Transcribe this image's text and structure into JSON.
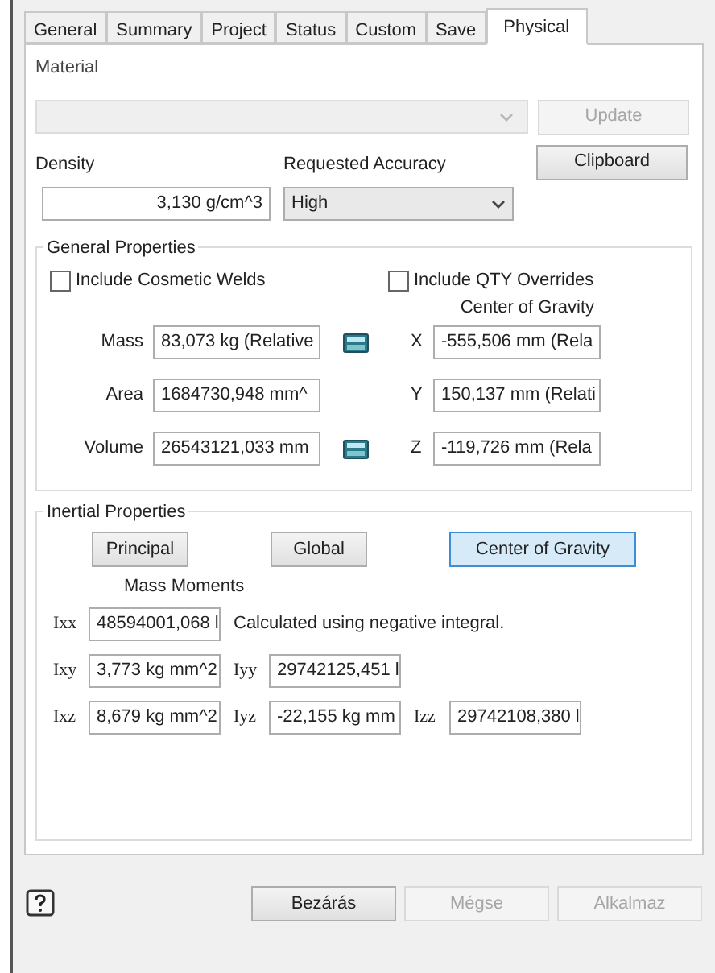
{
  "tabs": [
    {
      "label": "General",
      "selected": false
    },
    {
      "label": "Summary",
      "selected": false
    },
    {
      "label": "Project",
      "selected": false
    },
    {
      "label": "Status",
      "selected": false
    },
    {
      "label": "Custom",
      "selected": false
    },
    {
      "label": "Save",
      "selected": false
    },
    {
      "label": "Physical",
      "selected": true
    }
  ],
  "material": {
    "label": "Material",
    "disabled": true
  },
  "update_button": {
    "label": "Update",
    "disabled": true
  },
  "density": {
    "label": "Density",
    "value": "3,130 g/cm^3"
  },
  "accuracy": {
    "label": "Requested Accuracy",
    "value": "High"
  },
  "clipboard_button": {
    "label": "Clipboard",
    "disabled": false
  },
  "general_properties": {
    "title": "General Properties",
    "checkboxes": [
      {
        "label": "Include Cosmetic Welds",
        "checked": false
      },
      {
        "label": "Include QTY Overrides",
        "checked": false
      }
    ],
    "center_of_gravity_label": "Center of Gravity",
    "rows": [
      {
        "label": "Mass",
        "value": "83,073 kg (Relative",
        "calculator": true,
        "axis": "X",
        "cog": "-555,506 mm (Rela"
      },
      {
        "label": "Area",
        "value": "1684730,948 mm^",
        "calculator": false,
        "axis": "Y",
        "cog": "150,137 mm (Relati"
      },
      {
        "label": "Volume",
        "value": "26543121,033 mm",
        "calculator": true,
        "axis": "Z",
        "cog": "-119,726 mm (Rela"
      }
    ]
  },
  "inertial_properties": {
    "title": "Inertial Properties",
    "buttons": [
      {
        "label": "Principal",
        "selected": false
      },
      {
        "label": "Global",
        "selected": false
      },
      {
        "label": "Center of Gravity",
        "selected": true
      }
    ],
    "mass_moments_label": "Mass Moments",
    "note": "Calculated using negative integral.",
    "rows": [
      [
        {
          "label": "Ixx",
          "value": "48594001,068 l"
        }
      ],
      [
        {
          "label": "Ixy",
          "value": "3,773 kg mm^2"
        },
        {
          "label": "Iyy",
          "value": "29742125,451 l"
        }
      ],
      [
        {
          "label": "Ixz",
          "value": "8,679 kg mm^2"
        },
        {
          "label": "Iyz",
          "value": "-22,155 kg mm"
        },
        {
          "label": "Izz",
          "value": "29742108,380 l"
        }
      ]
    ]
  },
  "footer_buttons": [
    {
      "label": "Bezárás",
      "disabled": false
    },
    {
      "label": "Mégse",
      "disabled": true
    },
    {
      "label": "Alkalmaz",
      "disabled": true
    }
  ]
}
